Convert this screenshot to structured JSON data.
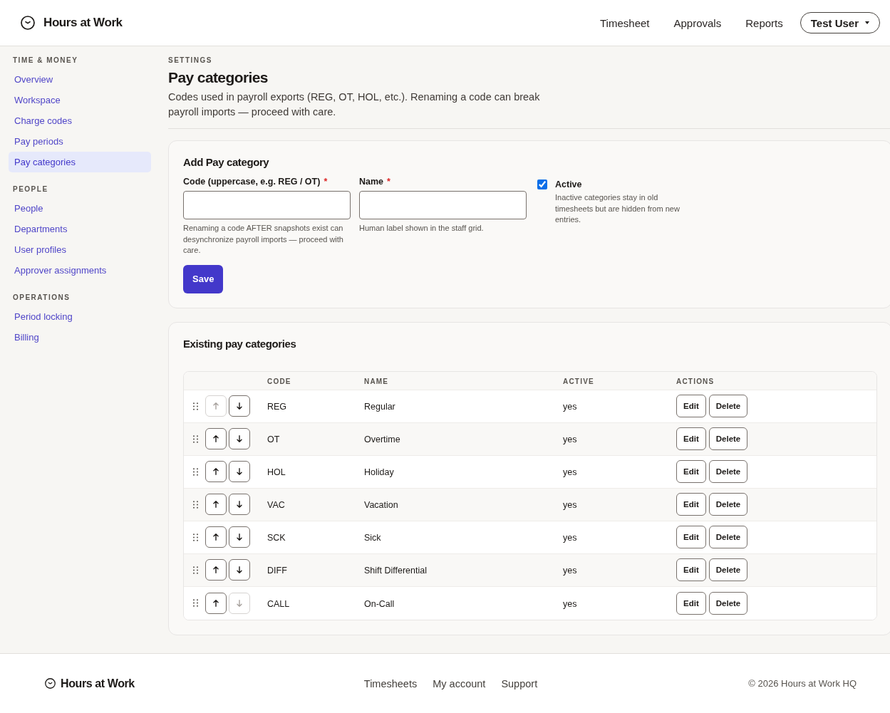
{
  "header": {
    "brand": "Hours at Work",
    "nav": [
      {
        "label": "Timesheet",
        "selected": false
      },
      {
        "label": "Approvals",
        "selected": false
      },
      {
        "label": "Reports",
        "selected": false
      }
    ],
    "user_menu": "Test User"
  },
  "sidebar": {
    "sections": [
      {
        "heading": "TIME & MONEY",
        "items": [
          {
            "label": "Overview",
            "selected": false
          },
          {
            "label": "Workspace",
            "selected": false
          },
          {
            "label": "Charge codes",
            "selected": false
          },
          {
            "label": "Pay periods",
            "selected": false
          },
          {
            "label": "Pay categories",
            "selected": true
          }
        ]
      },
      {
        "heading": "PEOPLE",
        "items": [
          {
            "label": "People",
            "selected": false
          },
          {
            "label": "Departments",
            "selected": false
          },
          {
            "label": "User profiles",
            "selected": false
          },
          {
            "label": "Approver assignments",
            "selected": false
          }
        ]
      },
      {
        "heading": "OPERATIONS",
        "items": [
          {
            "label": "Period locking",
            "selected": false
          },
          {
            "label": "Billing",
            "selected": false
          }
        ]
      }
    ]
  },
  "page": {
    "eyebrow": "SETTINGS",
    "title": "Pay categories",
    "description": "Codes used in payroll exports (REG, OT, HOL, etc.). Renaming a code can break payroll imports — proceed with care."
  },
  "add_form": {
    "title": "Add Pay category",
    "fields": [
      {
        "label": "Code (uppercase, e.g. REG / OT)",
        "required_mark": "*",
        "hint": "Renaming a code AFTER snapshots exist can desynchronize payroll imports — proceed with care."
      },
      {
        "label": "Name",
        "required_mark": "*",
        "hint": "Human label shown in the staff grid."
      }
    ],
    "active": {
      "label": "Active",
      "checked": true,
      "hint": "Inactive categories stay in old timesheets but are hidden from new entries."
    },
    "save_button": "Save"
  },
  "table": {
    "title": "Existing pay categories",
    "columns": [
      "CODE",
      "NAME",
      "ACTIVE",
      "ACTIONS"
    ],
    "rows": [
      {
        "code": "REG",
        "name": "Regular",
        "active": "yes",
        "up_disabled": true,
        "down_disabled": false,
        "actions": [
          "Edit",
          "Delete"
        ]
      },
      {
        "code": "OT",
        "name": "Overtime",
        "active": "yes",
        "up_disabled": false,
        "down_disabled": false,
        "actions": [
          "Edit",
          "Delete"
        ]
      },
      {
        "code": "HOL",
        "name": "Holiday",
        "active": "yes",
        "up_disabled": false,
        "down_disabled": false,
        "actions": [
          "Edit",
          "Delete"
        ]
      },
      {
        "code": "VAC",
        "name": "Vacation",
        "active": "yes",
        "up_disabled": false,
        "down_disabled": false,
        "actions": [
          "Edit",
          "Delete"
        ]
      },
      {
        "code": "SCK",
        "name": "Sick",
        "active": "yes",
        "up_disabled": false,
        "down_disabled": false,
        "actions": [
          "Edit",
          "Delete"
        ]
      },
      {
        "code": "DIFF",
        "name": "Shift Differential",
        "active": "yes",
        "up_disabled": false,
        "down_disabled": false,
        "actions": [
          "Edit",
          "Delete"
        ]
      },
      {
        "code": "CALL",
        "name": "On-Call",
        "active": "yes",
        "up_disabled": false,
        "down_disabled": true,
        "actions": [
          "Edit",
          "Delete"
        ]
      }
    ]
  },
  "footer": {
    "brand": "Hours at Work",
    "links": [
      "Timesheets",
      "My account",
      "Support"
    ],
    "copyright": "© 2026 Hours at Work HQ"
  }
}
